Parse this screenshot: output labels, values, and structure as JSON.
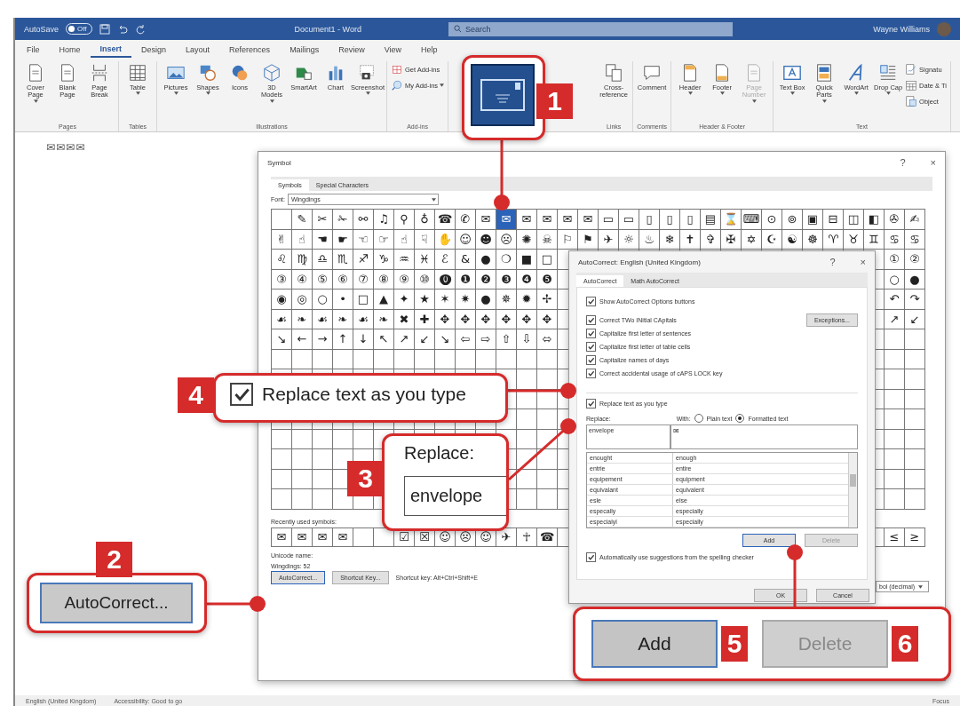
{
  "title_bar": {
    "autosave": "AutoSave",
    "autosave_state": "Off",
    "autosave_on": false,
    "title": "Document1 - Word",
    "search_placeholder": "Search",
    "user": "Wayne Williams"
  },
  "menu_tabs": [
    {
      "label": "File",
      "selected": false
    },
    {
      "label": "Home",
      "selected": false
    },
    {
      "label": "Insert",
      "selected": true
    },
    {
      "label": "Design",
      "selected": false
    },
    {
      "label": "Layout",
      "selected": false
    },
    {
      "label": "References",
      "selected": false
    },
    {
      "label": "Mailings",
      "selected": false
    },
    {
      "label": "Review",
      "selected": false
    },
    {
      "label": "View",
      "selected": false
    },
    {
      "label": "Help",
      "selected": false
    }
  ],
  "ribbon_groups": [
    {
      "label": "Pages",
      "items": [
        {
          "label": "Cover Page",
          "kind": "large",
          "dropdown": true,
          "disabled": false
        },
        {
          "label": "Blank Page",
          "kind": "large",
          "dropdown": false,
          "disabled": false
        },
        {
          "label": "Page Break",
          "kind": "large",
          "dropdown": false,
          "disabled": false
        }
      ]
    },
    {
      "label": "Tables",
      "items": [
        {
          "label": "Table",
          "kind": "large",
          "dropdown": true,
          "disabled": false
        }
      ]
    },
    {
      "label": "Illustrations",
      "items": [
        {
          "label": "Pictures",
          "kind": "large",
          "dropdown": true,
          "disabled": false
        },
        {
          "label": "Shapes",
          "kind": "large",
          "dropdown": true,
          "disabled": false
        },
        {
          "label": "Icons",
          "kind": "large",
          "dropdown": false,
          "disabled": false
        },
        {
          "label": "3D Models",
          "kind": "large",
          "dropdown": true,
          "disabled": false
        },
        {
          "label": "SmartArt",
          "kind": "large",
          "dropdown": false,
          "disabled": false
        },
        {
          "label": "Chart",
          "kind": "large",
          "dropdown": false,
          "disabled": false
        },
        {
          "label": "Screenshot",
          "kind": "large",
          "dropdown": true,
          "disabled": false
        }
      ]
    },
    {
      "label": "Add-ins",
      "items": [
        {
          "label": "Get Add-ins",
          "kind": "small",
          "dropdown": false,
          "disabled": false
        },
        {
          "label": "My Add-ins",
          "kind": "small",
          "dropdown": true,
          "disabled": false
        }
      ]
    },
    {
      "label": "Links",
      "items": [
        {
          "label": "Cross-reference",
          "kind": "large",
          "dropdown": false,
          "disabled": false
        }
      ]
    },
    {
      "label": "Comments",
      "items": [
        {
          "label": "Comment",
          "kind": "large",
          "dropdown": false,
          "disabled": false
        }
      ]
    },
    {
      "label": "Header & Footer",
      "items": [
        {
          "label": "Header",
          "kind": "large",
          "dropdown": true,
          "disabled": false
        },
        {
          "label": "Footer",
          "kind": "large",
          "dropdown": true,
          "disabled": false
        },
        {
          "label": "Page Number",
          "kind": "large",
          "dropdown": true,
          "disabled": true
        }
      ]
    },
    {
      "label": "Text",
      "items": [
        {
          "label": "Text Box",
          "kind": "large",
          "dropdown": true,
          "disabled": false
        },
        {
          "label": "Quick Parts",
          "kind": "large",
          "dropdown": true,
          "disabled": false
        },
        {
          "label": "WordArt",
          "kind": "large",
          "dropdown": true,
          "disabled": false
        },
        {
          "label": "Drop Cap",
          "kind": "large",
          "dropdown": true,
          "disabled": false
        },
        {
          "label": "Signatu",
          "kind": "small",
          "dropdown": false,
          "disabled": false
        },
        {
          "label": "Date & Ti",
          "kind": "small",
          "dropdown": false,
          "disabled": false
        },
        {
          "label": "Object",
          "kind": "small",
          "dropdown": false,
          "disabled": false
        }
      ]
    }
  ],
  "document_text": "✉✉✉✉",
  "symbol_dialog": {
    "title": "Symbol",
    "help": "?",
    "close": "×",
    "tabs": [
      {
        "label": "Symbols",
        "selected": true
      },
      {
        "label": "Special Characters",
        "selected": false
      }
    ],
    "font_label": "Font:",
    "font_value": "Wingdings",
    "grid_rows": [
      {
        "kind": "indented",
        "left": [
          "✎",
          "✂",
          "✁",
          "⚯",
          "♫",
          "⚲",
          "♁",
          "☎",
          "✆",
          "✉"
        ],
        "highlighted_glyph": "✉",
        "after": [
          "✉",
          "✉",
          "✉",
          "✉",
          "▭",
          "▭",
          "▯",
          "▯",
          "▯",
          "▤",
          "⌛",
          "⌨",
          "⊙",
          "⊚",
          "▣",
          "⊟",
          "◫",
          "◧",
          "✇",
          "✍"
        ]
      },
      {
        "kind": "flush",
        "left": [
          "✌",
          "☝",
          "☚",
          "☛",
          "☜",
          "☞",
          "☝",
          "☟",
          "✋",
          "☺",
          "☻",
          "☹",
          "✺",
          "☠",
          "⚐",
          "⚑",
          "✈",
          "☼",
          "♨",
          "❄",
          "✝",
          "✞",
          "✠",
          "✡",
          "☪",
          "☯",
          "☸",
          "♈",
          "♉",
          "♊",
          "♋",
          "♋"
        ]
      },
      {
        "kind": "flush",
        "left": [
          "♌",
          "♍",
          "♎",
          "♏",
          "♐",
          "♑",
          "♒",
          "♓",
          "ℰ",
          "&",
          "●",
          "❍",
          "■",
          "□"
        ],
        "right": [
          "①",
          "②"
        ]
      },
      {
        "kind": "flush",
        "left": [
          "③",
          "④",
          "⑤",
          "⑥",
          "⑦",
          "⑧",
          "⑨",
          "⑩",
          "⓿",
          "❶",
          "❷",
          "❸",
          "❹",
          "❺"
        ],
        "right": [
          "○",
          "●"
        ]
      },
      {
        "kind": "flush",
        "left": [
          "◉",
          "◎",
          "○",
          "•",
          "□",
          "▲",
          "✦",
          "★",
          "✶",
          "✷",
          "●",
          "✵",
          "✹",
          "✢"
        ],
        "right": [
          "↶",
          "↷"
        ]
      },
      {
        "kind": "flush",
        "left": [
          "☙",
          "❧",
          "☙",
          "❧",
          "☙",
          "❧",
          "✖",
          "✚",
          "✥",
          "✥",
          "✥",
          "✥",
          "✥",
          "✥"
        ],
        "right": [
          "↗",
          "↙"
        ]
      },
      {
        "kind": "flush",
        "left": [
          "↘",
          "←",
          "→",
          "↑",
          "↓",
          "↖",
          "↗",
          "↙",
          "↘",
          "⇦",
          "⇨",
          "⇧",
          "⇩",
          "⬄"
        ]
      },
      {
        "kind": "empty"
      },
      {
        "kind": "empty"
      },
      {
        "kind": "empty"
      },
      {
        "kind": "empty"
      },
      {
        "kind": "empty"
      },
      {
        "kind": "empty"
      },
      {
        "kind": "empty"
      },
      {
        "kind": "empty"
      }
    ],
    "recent_label": "Recently used symbols:",
    "recent_left": [
      "✉",
      "✉",
      "✉",
      "✉"
    ],
    "recent_mid": [
      "☑",
      "☒",
      "☺",
      "☹",
      "☺",
      "✈",
      "☥",
      "☎"
    ],
    "recent_right": [
      "≤",
      "≥"
    ],
    "unicode_label": "Unicode name:",
    "char_name": "Wingdings: 52",
    "buttons": [
      {
        "label": "AutoCorrect..."
      },
      {
        "label": "Shortcut Key..."
      }
    ],
    "shortcut_text": "Shortcut key: Alt+Ctrl+Shift+E",
    "from_value": "bol (decimal)"
  },
  "autocorrect_dialog": {
    "title": "AutoCorrect: English (United Kingdom)",
    "help": "?",
    "close": "×",
    "tabs": [
      {
        "label": "AutoCorrect",
        "selected": true
      },
      {
        "label": "Math AutoCorrect",
        "selected": false
      }
    ],
    "options": [
      {
        "label": "Show AutoCorrect Options buttons",
        "checked": true
      },
      {
        "label": "Correct TWo INitial CApitals",
        "checked": true
      },
      {
        "label": "Capitalize first letter of sentences",
        "checked": true
      },
      {
        "label": "Capitalize first letter of table cells",
        "checked": true
      },
      {
        "label": "Capitalize names of days",
        "checked": true
      },
      {
        "label": "Correct accidental usage of cAPS LOCK key",
        "checked": true
      }
    ],
    "exceptions_button": "Exceptions...",
    "replace_option": {
      "label": "Replace text as you type",
      "checked": true
    },
    "replace_label": "Replace:",
    "with_label": "With:",
    "radios": [
      {
        "label": "Plain text",
        "selected": false
      },
      {
        "label": "Formatted text",
        "selected": true
      }
    ],
    "replace_value": "envelope",
    "with_value": "✉",
    "entries": [
      {
        "from": "enought",
        "to": "enough"
      },
      {
        "from": "entrie",
        "to": "entire"
      },
      {
        "from": "equipement",
        "to": "equipment"
      },
      {
        "from": "equivalant",
        "to": "equivalent"
      },
      {
        "from": "esle",
        "to": "else"
      },
      {
        "from": "especally",
        "to": "especially"
      },
      {
        "from": "especialyl",
        "to": "especially"
      }
    ],
    "buttons": [
      {
        "label": "Add",
        "disabled": false
      },
      {
        "label": "Delete",
        "disabled": true
      }
    ],
    "spelling_option": {
      "label": "Automatically use suggestions from the spelling checker",
      "checked": true
    },
    "footer_buttons": [
      {
        "label": "OK"
      },
      {
        "label": "Cancel"
      }
    ]
  },
  "callouts": [
    {
      "kind": "icon_button",
      "badge": "1"
    },
    {
      "kind": "checkbox",
      "badge": "4",
      "label": "Replace text as you type",
      "checked": true
    },
    {
      "kind": "field",
      "badge": "3",
      "label": "Replace:",
      "value": "envelope"
    },
    {
      "kind": "button",
      "badge": "2",
      "label": "AutoCorrect..."
    },
    {
      "kind": "button_pair",
      "buttons": [
        {
          "label": "Add",
          "badge": "5",
          "disabled": false
        },
        {
          "label": "Delete",
          "badge": "6",
          "disabled": true
        }
      ]
    }
  ],
  "status_bar": {
    "language": "English (United Kingdom)",
    "accessibility": "Accessibility: Good to go",
    "focus": "Focus"
  }
}
